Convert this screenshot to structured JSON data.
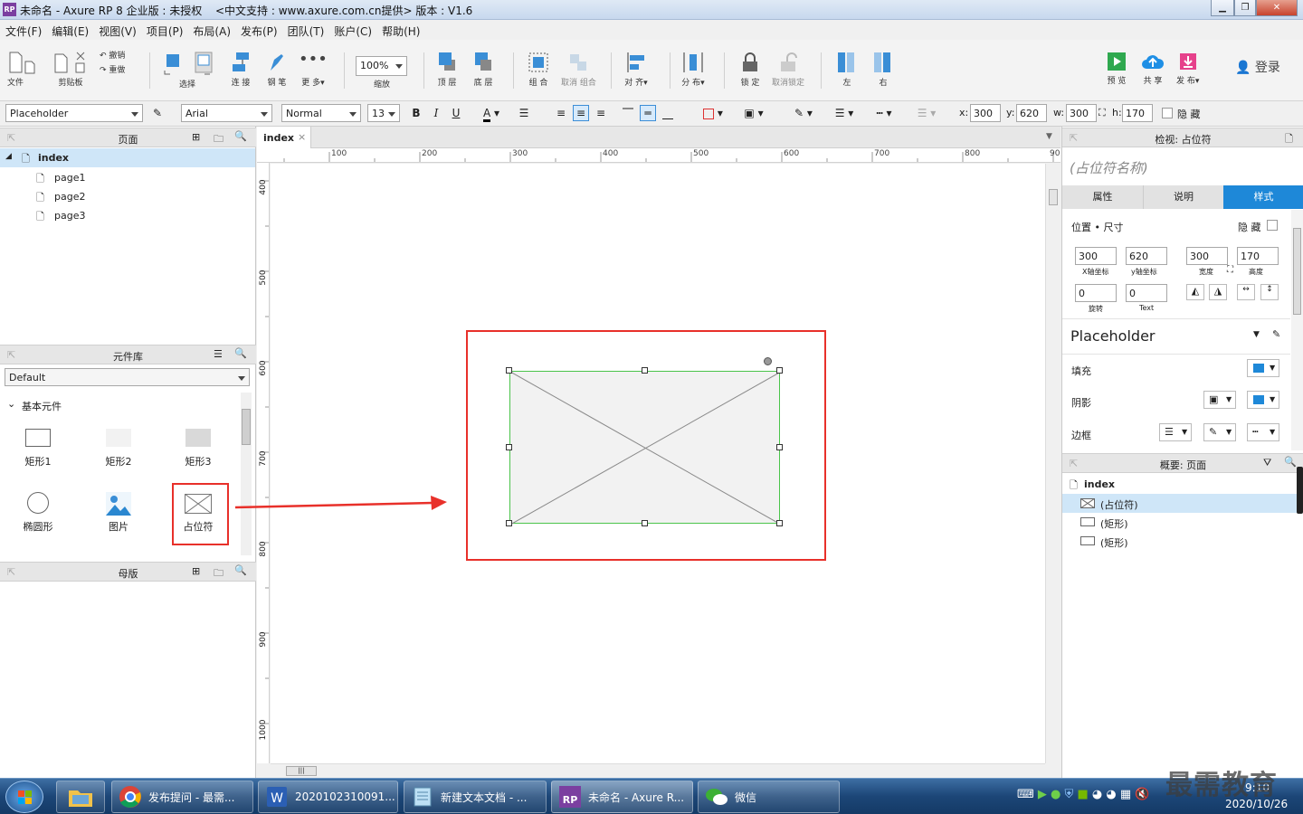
{
  "window": {
    "title": "未命名 - Axure RP 8 企业版 : 未授权",
    "support": "<中文支持 : www.axure.com.cn提供> 版本 : V1.6"
  },
  "menu": [
    "文件(F)",
    "编辑(E)",
    "视图(V)",
    "项目(P)",
    "布局(A)",
    "发布(P)",
    "团队(T)",
    "账户(C)",
    "帮助(H)"
  ],
  "toolbar": {
    "file": "文件",
    "clipboard": "剪贴板",
    "undo": "撤销",
    "redo": "重做",
    "select": "选择",
    "connect": "连 接",
    "pen": "钢 笔",
    "more": "更 多▾",
    "zoom_value": "100%",
    "zoom": "缩放",
    "top": "顶 层",
    "bottom": "底 层",
    "group": "组 合",
    "ungroup": "取消 组合",
    "align": "对 齐▾",
    "distribute": "分 布▾",
    "lock": "锁 定",
    "unlock": "取消锁定",
    "left": "左",
    "right": "右",
    "preview": "预 览",
    "share": "共 享",
    "publish": "发 布▾",
    "login": "登录"
  },
  "format": {
    "style": "Placeholder",
    "font": "Arial",
    "weight": "Normal",
    "size": "13",
    "x_label": "x:",
    "x": "300",
    "y_label": "y:",
    "y": "620",
    "w_label": "w:",
    "w": "300",
    "h_label": "h:",
    "h": "170",
    "hidden": "隐 藏"
  },
  "pages_panel": {
    "title": "页面",
    "root": "index",
    "pages": [
      "page1",
      "page2",
      "page3"
    ]
  },
  "library_panel": {
    "title": "元件库",
    "selected": "Default",
    "group": "基本元件",
    "widgets": [
      "矩形1",
      "矩形2",
      "矩形3",
      "椭圆形",
      "图片",
      "占位符"
    ]
  },
  "masters_panel": {
    "title": "母版"
  },
  "canvas": {
    "tab": "index",
    "ruler_h": [
      "100",
      "200",
      "300",
      "400",
      "500",
      "600",
      "700",
      "800",
      "90"
    ],
    "ruler_v": [
      "400",
      "500",
      "600",
      "700",
      "800",
      "900",
      "1000"
    ]
  },
  "inspector": {
    "title": "检视: 占位符",
    "name_placeholder": "(占位符名称)",
    "tabs": [
      "属性",
      "说明",
      "样式"
    ],
    "section": "位置 • 尺寸",
    "hidden": "隐 藏",
    "x": "300",
    "y": "620",
    "w": "300",
    "h": "170",
    "x_lbl": "X轴坐标",
    "y_lbl": "y轴坐标",
    "w_lbl": "宽度",
    "h_lbl": "高度",
    "rotate": "0",
    "text_rotate": "0",
    "rotate_lbl": "旋转",
    "text_lbl": "Text",
    "style_name": "Placeholder",
    "fill": "填充",
    "shadow": "阴影",
    "border": "边框"
  },
  "outline_panel": {
    "title": "概要: 页面",
    "root": "index",
    "items": [
      "(占位符)",
      "(矩形)",
      "(矩形)"
    ]
  },
  "taskbar": {
    "tasks": [
      "发布提问 - 最需...",
      "2020102310091...",
      "新建文本文档 - ...",
      "未命名 - Axure R...",
      "微信"
    ],
    "time": "9:10",
    "date": "2020/10/26",
    "watermark": "最需教育"
  },
  "colors": {
    "accent": "#3a8ed6",
    "selection": "#cfe6f8",
    "highlight_box": "#e8302a",
    "widget_border": "#4bc44b"
  }
}
